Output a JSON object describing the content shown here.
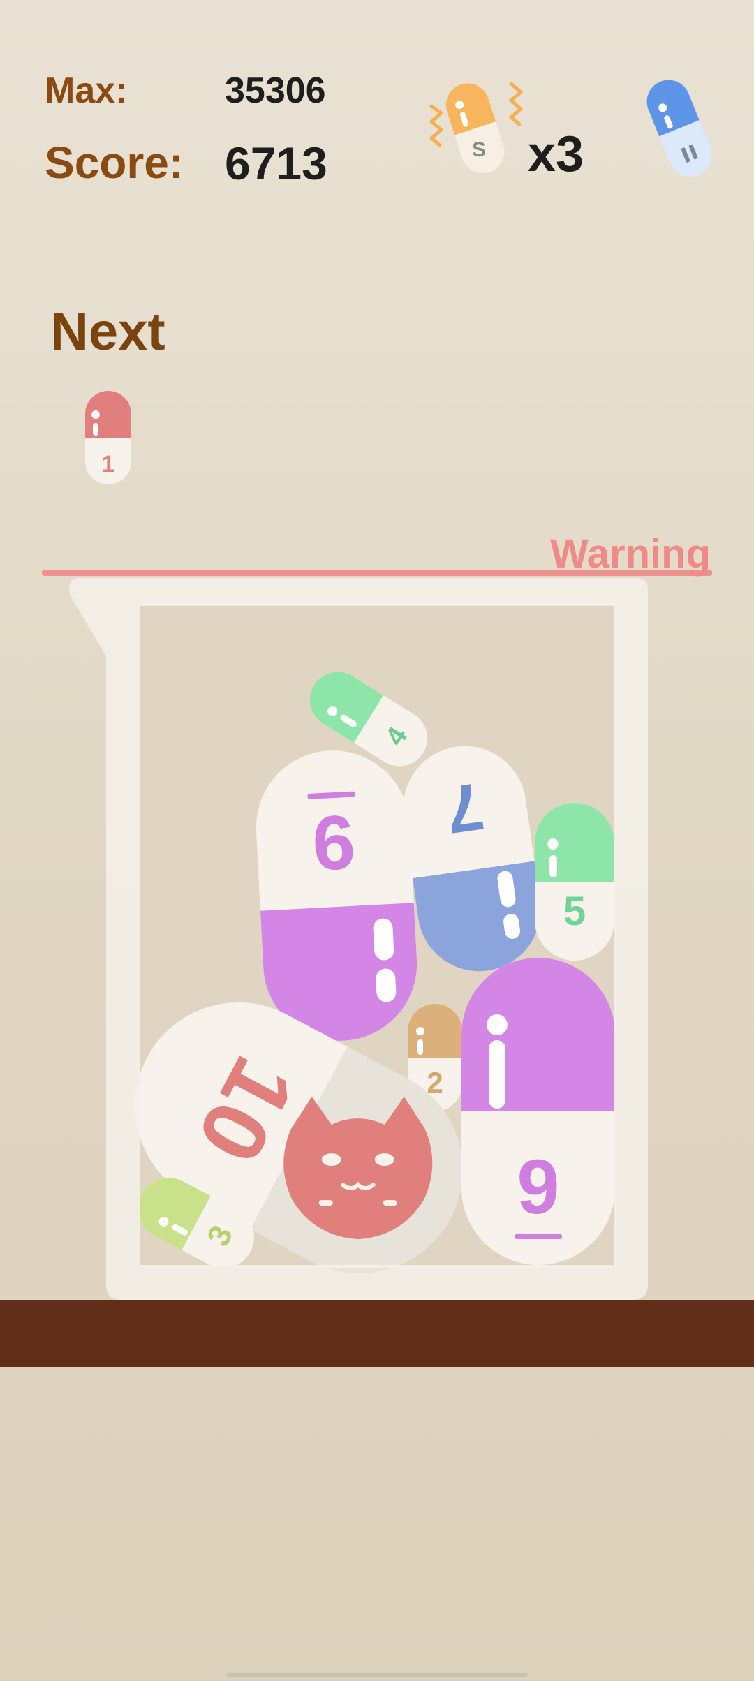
{
  "hud": {
    "max_label": "Max:",
    "max_value": "35306",
    "score_label": "Score:",
    "score_value": "6713",
    "shake_label": "S",
    "shake_count": "x3",
    "pause_icon": "pause-pill-icon"
  },
  "next": {
    "label": "Next",
    "pill_number": "1"
  },
  "warning": {
    "label": "Warning"
  },
  "beaker": {
    "pills": [
      {
        "number": "4"
      },
      {
        "number": "6"
      },
      {
        "number": "7"
      },
      {
        "number": "5"
      },
      {
        "number": "2"
      },
      {
        "number": "10"
      },
      {
        "number": "9"
      },
      {
        "number": "3"
      }
    ]
  },
  "colors": {
    "label_brown": "#8a4a12",
    "warning_red": "#ef8a86",
    "shelf_brown": "#612e17",
    "beaker_glass": "#f3efe7",
    "pill_white": "#f7f3ec",
    "pill_red": "#e07f7c",
    "pill_green": "#8ee5aa",
    "pill_purple": "#d486e6",
    "pill_blue": "#8ba5dc",
    "pill_mint": "#8ee5aa",
    "pill_tan": "#dcb07a",
    "pill_lime": "#c9e28a",
    "shake_orange": "#f7b55e",
    "pause_blue": "#5f95e8"
  }
}
